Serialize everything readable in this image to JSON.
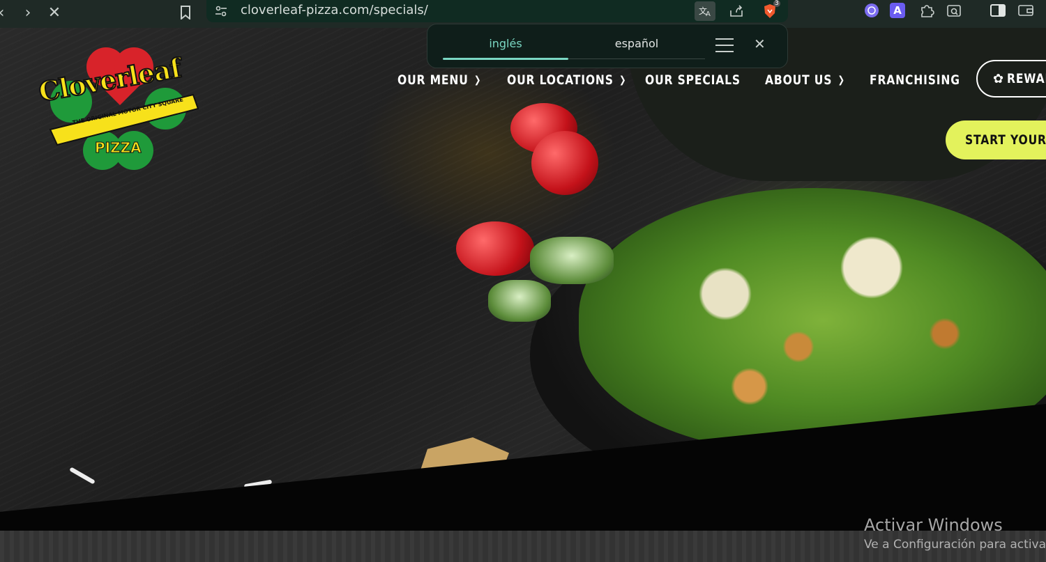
{
  "browser": {
    "url": "cloverleaf-pizza.com/specials/",
    "brave_badge_count": "3",
    "extension_letter": "A"
  },
  "translate_popup": {
    "tab_source": "inglés",
    "tab_target": "español"
  },
  "site": {
    "logo": {
      "name": "Cloverleaf",
      "tagline": "THE ORIGINAL MOTOR CITY SQUARE",
      "product": "PIZZA"
    },
    "nav": [
      {
        "label": "OUR MENU",
        "has_dropdown": true
      },
      {
        "label": "OUR LOCATIONS",
        "has_dropdown": true
      },
      {
        "label": "OUR SPECIALS",
        "has_dropdown": false
      },
      {
        "label": "ABOUT US",
        "has_dropdown": true
      },
      {
        "label": "FRANCHISING",
        "has_dropdown": false
      }
    ],
    "rewards_label": "REWAR",
    "start_order_label": "START YOUR O",
    "colors": {
      "accent": "#e3f25c",
      "logo_red": "#d8232a",
      "logo_green": "#1f9a3a",
      "logo_yellow": "#f7e11b"
    }
  },
  "os_watermark": {
    "title": "Activar Windows",
    "subtitle": "Ve a Configuración para activar"
  }
}
